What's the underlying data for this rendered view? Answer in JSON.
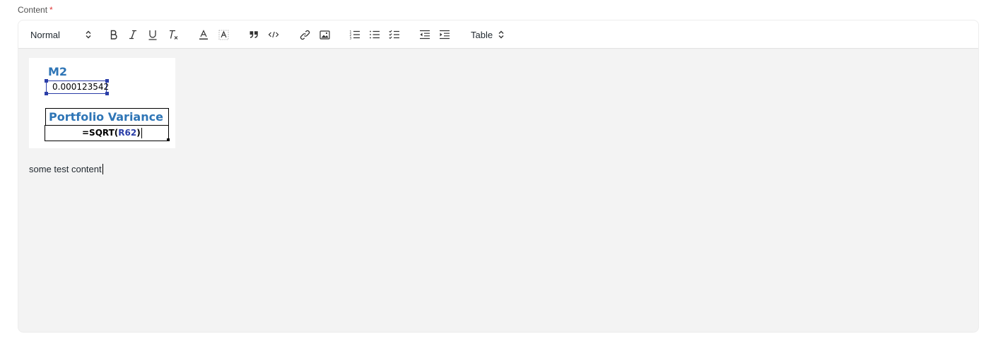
{
  "field": {
    "label": "Content",
    "required_mark": "*"
  },
  "toolbar": {
    "header_select": "Normal",
    "table_select": "Table",
    "buttons": [
      "bold-icon",
      "italic-icon",
      "underline-icon",
      "clear-format-icon",
      "text-color-icon",
      "background-color-icon",
      "blockquote-icon",
      "code-icon",
      "link-icon",
      "image-icon",
      "ordered-list-icon",
      "bullet-list-icon",
      "check-list-icon",
      "outdent-icon",
      "indent-icon"
    ]
  },
  "content": {
    "image": {
      "heading": "M2",
      "cell_value": "0.000123542",
      "variance_label": "Portfolio Variance",
      "formula_prefix": "=SQRT(",
      "formula_ref": "R62",
      "formula_suffix": ")"
    },
    "paragraph": "some test content"
  },
  "colors": {
    "accent_blue": "#2e75b6",
    "selection_blue": "#2b3ea8",
    "required_red": "#e03636"
  }
}
